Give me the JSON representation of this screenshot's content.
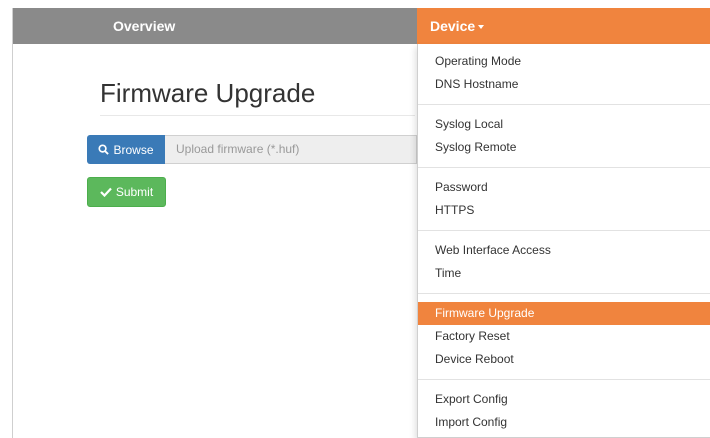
{
  "navbar": {
    "overview_label": "Overview",
    "device_label": "Device",
    "colors": {
      "navbar_bg": "#8a8a8a",
      "accent": "#f0843e"
    }
  },
  "main": {
    "page_title": "Firmware Upgrade",
    "browse_label": "Browse",
    "browse_icon": "search-icon",
    "upload_placeholder": "Upload firmware (*.huf)",
    "submit_label": "Submit",
    "submit_icon": "check-icon"
  },
  "dropdown": {
    "groups": [
      [
        "Operating Mode",
        "DNS Hostname"
      ],
      [
        "Syslog Local",
        "Syslog Remote"
      ],
      [
        "Password",
        "HTTPS"
      ],
      [
        "Web Interface Access",
        "Time"
      ],
      [
        "Firmware Upgrade",
        "Factory Reset",
        "Device Reboot"
      ],
      [
        "Export Config",
        "Import Config"
      ]
    ],
    "active_item": "Firmware Upgrade"
  }
}
